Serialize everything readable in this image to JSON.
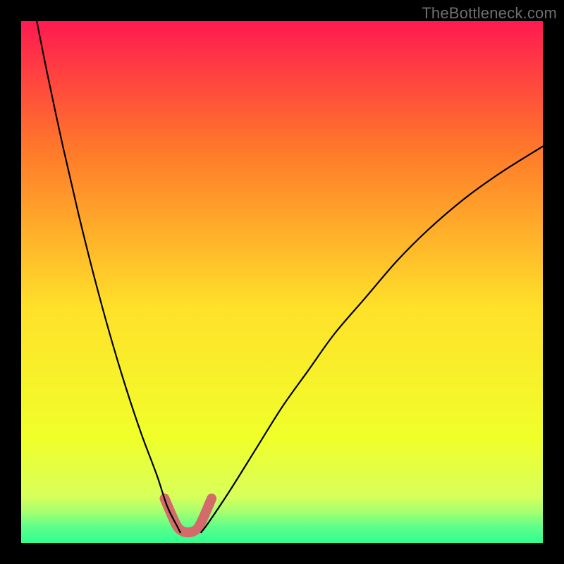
{
  "watermark": "TheBottleneck.com",
  "chart_data": {
    "type": "line",
    "title": "",
    "xlabel": "",
    "ylabel": "",
    "xlim": [
      0,
      1
    ],
    "ylim": [
      0,
      1
    ],
    "background_gradient": {
      "top": "#ff1a50",
      "upper_mid": "#ff7a2a",
      "mid": "#ffe12a",
      "lower_mid": "#f0ff2a",
      "bottom_band_1": "#d8ff5a",
      "bottom_band_2": "#a8ff70",
      "bottom_band_3": "#5cff8a",
      "bottom": "#2fff8f"
    },
    "series": [
      {
        "name": "curve-left",
        "color": "#000000",
        "x": [
          0.03,
          0.05,
          0.08,
          0.11,
          0.14,
          0.17,
          0.2,
          0.23,
          0.26,
          0.28,
          0.3,
          0.305
        ],
        "y": [
          1.0,
          0.9,
          0.76,
          0.63,
          0.51,
          0.4,
          0.3,
          0.21,
          0.13,
          0.07,
          0.03,
          0.02
        ]
      },
      {
        "name": "curve-right",
        "color": "#000000",
        "x": [
          0.345,
          0.36,
          0.4,
          0.45,
          0.5,
          0.55,
          0.6,
          0.66,
          0.72,
          0.78,
          0.85,
          0.92,
          1.0
        ],
        "y": [
          0.02,
          0.04,
          0.1,
          0.18,
          0.26,
          0.33,
          0.4,
          0.47,
          0.54,
          0.6,
          0.66,
          0.71,
          0.76
        ]
      },
      {
        "name": "highlight-band",
        "color": "#d46a6a",
        "stroke_width": 14,
        "x": [
          0.275,
          0.29,
          0.3,
          0.31,
          0.32,
          0.33,
          0.34,
          0.35,
          0.365
        ],
        "y": [
          0.085,
          0.05,
          0.03,
          0.022,
          0.02,
          0.022,
          0.03,
          0.05,
          0.085
        ]
      }
    ]
  }
}
